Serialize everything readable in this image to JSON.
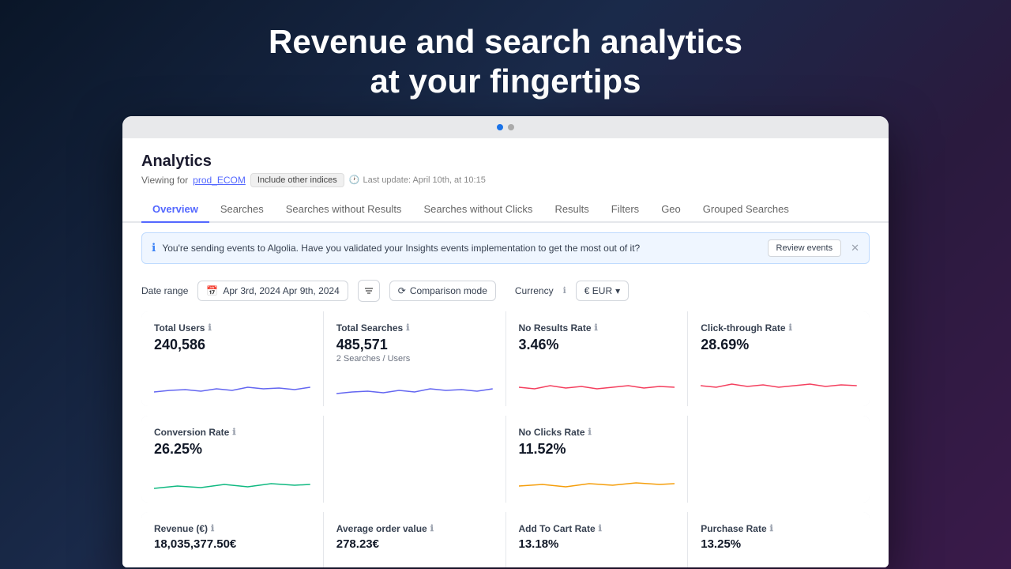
{
  "hero": {
    "line1": "Revenue and search analytics",
    "line2": "at your fingertips"
  },
  "browser": {
    "dot1": "active",
    "dot2": "inactive"
  },
  "analytics": {
    "title": "Analytics",
    "subtitle_prefix": "Viewing for",
    "index_name": "prod_ECOM",
    "include_btn": "Include other indices",
    "last_update": "Last update: April 10th, at 10:15",
    "clock_icon": "🕐"
  },
  "nav_tabs": [
    {
      "label": "Overview",
      "active": true
    },
    {
      "label": "Searches",
      "active": false
    },
    {
      "label": "Searches without Results",
      "active": false
    },
    {
      "label": "Searches without Clicks",
      "active": false
    },
    {
      "label": "Results",
      "active": false
    },
    {
      "label": "Filters",
      "active": false
    },
    {
      "label": "Geo",
      "active": false
    },
    {
      "label": "Grouped Searches",
      "active": false
    }
  ],
  "alert": {
    "text": "You're sending events to Algolia. Have you validated your Insights events implementation to get the most out of it?",
    "review_btn": "Review events",
    "info_icon": "ℹ"
  },
  "controls": {
    "date_range_label": "Date range",
    "date_value": "Apr 3rd, 2024  Apr 9th, 2024",
    "calendar_icon": "📅",
    "comparison_label": "Comparison mode",
    "comparison_icon": "⟳",
    "currency_label": "Currency",
    "currency_value": "€ EUR",
    "info_icon": "ℹ"
  },
  "metrics_row1": [
    {
      "title": "Total Users",
      "value": "240,586",
      "sub": "",
      "line_color": "#6366f1"
    },
    {
      "title": "Total Searches",
      "value": "485,571",
      "sub": "2 Searches / Users",
      "line_color": "#6366f1"
    },
    {
      "title": "No Results Rate",
      "value": "3.46%",
      "sub": "",
      "line_color": "#f43f5e"
    },
    {
      "title": "Click-through Rate",
      "value": "28.69%",
      "sub": "",
      "line_color": "#f43f5e"
    }
  ],
  "metrics_row2_left": [
    {
      "title": "Conversion Rate",
      "value": "26.25%",
      "sub": "",
      "line_color": "#10b981"
    },
    {
      "title": "No Clicks Rate",
      "value": "11.52%",
      "sub": "",
      "line_color": "#f59e0b"
    }
  ],
  "metrics_row3": [
    {
      "title": "Revenue (€)",
      "value": "18,035,377.50€",
      "sub": "",
      "line_color": "#6366f1"
    },
    {
      "title": "Average order value",
      "value": "278.23€",
      "sub": "",
      "line_color": "#6366f1"
    },
    {
      "title": "Add To Cart Rate",
      "value": "13.18%",
      "sub": "",
      "line_color": "#10b981"
    },
    {
      "title": "Purchase Rate",
      "value": "13.25%",
      "sub": "",
      "line_color": "#6366f1"
    }
  ]
}
